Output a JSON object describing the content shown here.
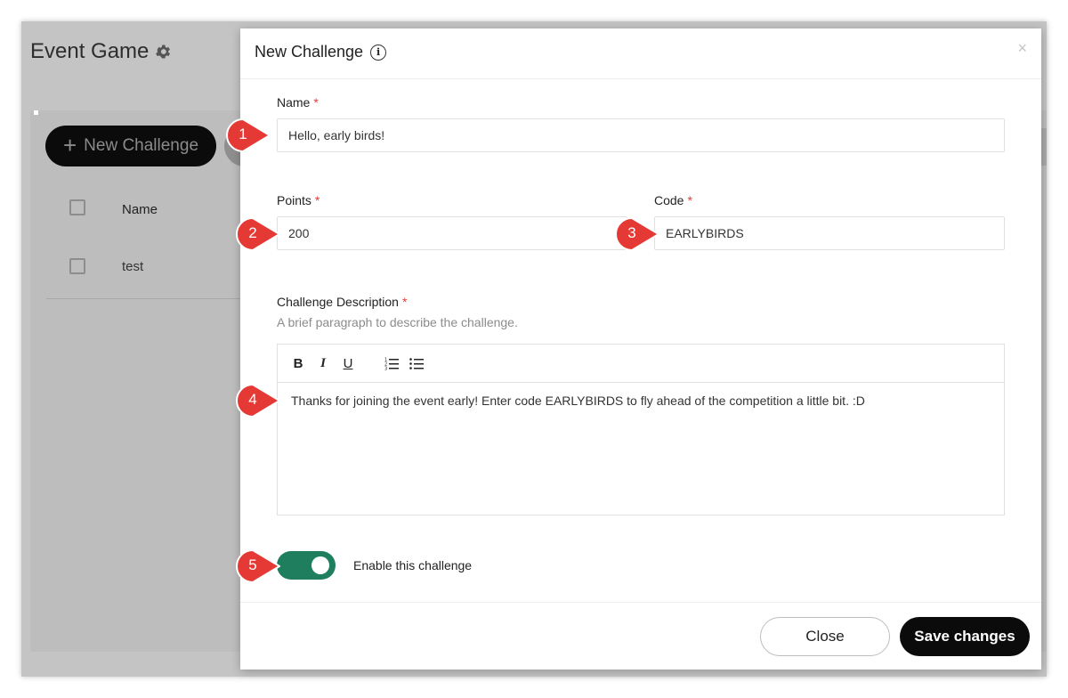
{
  "background": {
    "page_title": "Event Game",
    "new_challenge_label": "New Challenge",
    "table_header_name": "Name",
    "rows": [
      "test"
    ]
  },
  "modal": {
    "title": "New Challenge",
    "close_symbol": "×",
    "fields": {
      "name_label": "Name",
      "name_value": "Hello, early birds!",
      "points_label": "Points",
      "points_value": "200",
      "code_label": "Code",
      "code_value": "EARLYBIRDS",
      "description_label": "Challenge Description",
      "description_help": "A brief paragraph to describe the challenge.",
      "description_value": "Thanks for joining the event early! Enter code EARLYBIRDS to fly ahead of the competition a little bit. :D",
      "required_marker": "*"
    },
    "toolbar": {
      "bold": "B",
      "italic": "I",
      "underline": "U"
    },
    "toggle": {
      "label": "Enable this challenge",
      "on": true
    },
    "footer": {
      "close_label": "Close",
      "save_label": "Save changes"
    }
  },
  "callouts": [
    "1",
    "2",
    "3",
    "4",
    "5"
  ],
  "colors": {
    "toggle_on": "#1e7e5d",
    "callout": "#e53935",
    "primary_button": "#0b0b0b",
    "required": "#e53935"
  },
  "icons": [
    "gear-icon",
    "plus-icon",
    "info-icon",
    "close-icon",
    "ordered-list-icon",
    "bullet-list-icon"
  ]
}
